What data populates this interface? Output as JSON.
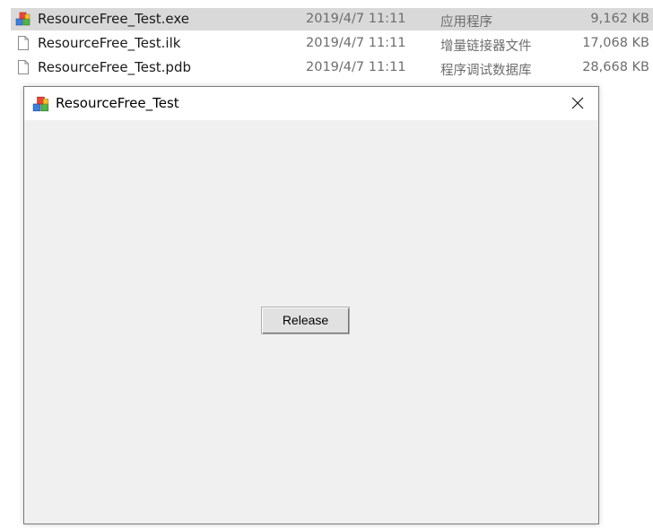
{
  "files": [
    {
      "name": "ResourceFree_Test.exe",
      "date": "2019/4/7 11:11",
      "type": "应用程序",
      "size": "9,162 KB",
      "icon": "application-icon",
      "selected": true
    },
    {
      "name": "ResourceFree_Test.ilk",
      "date": "2019/4/7 11:11",
      "type": "增量链接器文件",
      "size": "17,068 KB",
      "icon": "file-icon",
      "selected": false
    },
    {
      "name": "ResourceFree_Test.pdb",
      "date": "2019/4/7 11:11",
      "type": "程序调试数据库",
      "size": "28,668 KB",
      "icon": "file-icon",
      "selected": false
    }
  ],
  "dialog": {
    "title": "ResourceFree_Test",
    "close_icon": "close-icon",
    "release_label": "Release"
  },
  "colors": {
    "selection": "#d9d9d9",
    "dialog_background": "#f0f0f0",
    "button_face": "#e1e1e1",
    "secondary_text": "#6d6d6d"
  }
}
